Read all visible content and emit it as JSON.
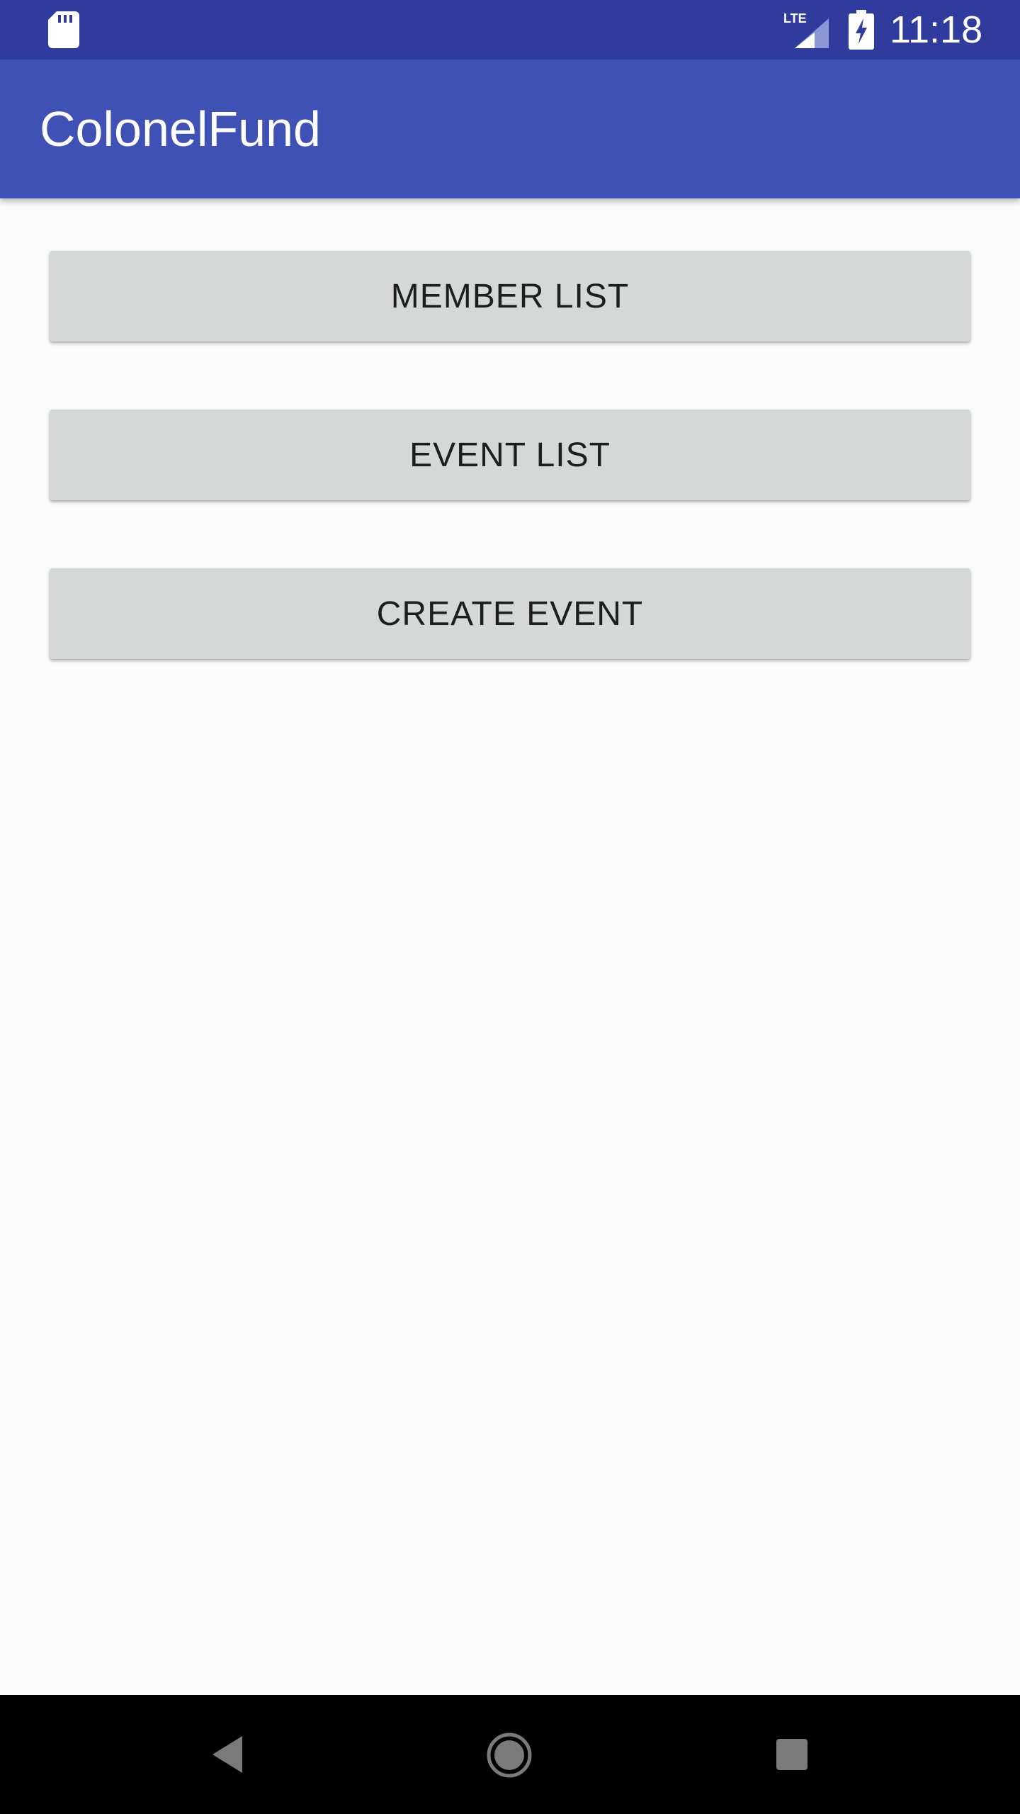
{
  "status_bar": {
    "time": "11:18",
    "network_label": "LTE",
    "icons": [
      "sd-card-icon",
      "lte-signal-icon",
      "battery-charging-icon"
    ]
  },
  "app_bar": {
    "title": "ColonelFund"
  },
  "main": {
    "buttons": [
      {
        "label": "MEMBER LIST"
      },
      {
        "label": "EVENT LIST"
      },
      {
        "label": "CREATE EVENT"
      }
    ]
  },
  "nav_bar": {
    "icons": [
      "back-icon",
      "home-icon",
      "recents-icon"
    ]
  },
  "colors": {
    "status_bar": "#2f3c9e",
    "app_bar": "#3f51b5",
    "background": "#fafafa",
    "button": "#d6d7d7",
    "nav_bar": "#000000"
  }
}
